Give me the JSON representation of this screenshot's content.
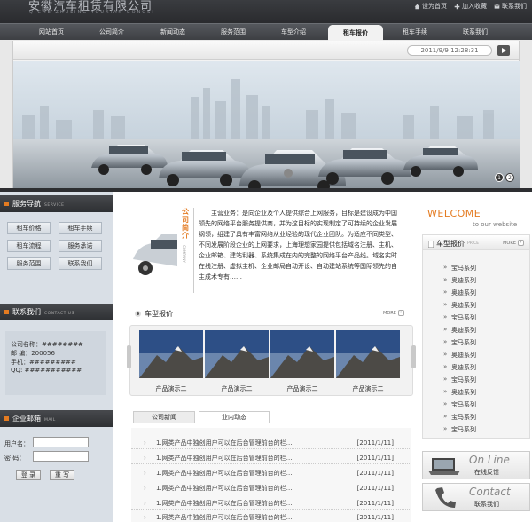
{
  "header": {
    "logo_cn": "安徽汽车租赁有限公司",
    "logo_pinyin": "QICHE ZHULING YOUXIAN GONGSI",
    "links": [
      "设为首页",
      "加入收藏",
      "联系我们"
    ]
  },
  "nav": {
    "items": [
      "网站首页",
      "公司简介",
      "新闻动态",
      "服务范围",
      "车型介绍",
      "租车报价",
      "租车手续",
      "联系我们"
    ],
    "active_index": 5
  },
  "banner": {
    "datetime": "2011/9/9 12:28:31",
    "slides": [
      "1",
      "2"
    ],
    "active_slide": 1
  },
  "sidebar": {
    "service_nav": {
      "title": "服务导航",
      "title_en": "SERVICE",
      "buttons": [
        "租车价格",
        "租车手续",
        "租车流程",
        "服务承诺",
        "服务范围",
        "联系我们"
      ]
    },
    "contact": {
      "title": "联系我们",
      "title_en": "CONTACT US",
      "lines": [
        "公司名称：########",
        "邮    编：200056",
        "手机：#########",
        "QQ: ###########"
      ]
    },
    "mail": {
      "title": "企业邮箱",
      "title_en": "MAIL",
      "user_label": "用户名：",
      "pass_label": "密    码：",
      "login_button": "登 录",
      "reset_button": "重 写"
    }
  },
  "intro": {
    "title_chars": [
      "公",
      "司",
      "简",
      "介"
    ],
    "subtitle": "COMPANY",
    "text": "主营业务：是向企业及个人提供综合上网服务，目标是建设成为中国领先的网络平台服务提供商，并为这目标的实现制定了可持续的企业发展纲领，组建了具有丰富网络从业经验的现代企业团队。为适应不同类型、不同发展阶段企业的上网要求，上海理想家园提供包括域名注册、主机、企业邮箱、建站利器、系统集成在内的完整的网络平台产品线。域名实时在线注册、虚拟主机、企业邮局自动开设、自动建站系统等国际领先的自主成术专有……"
  },
  "models_section": {
    "title": "车型报价",
    "more": "MORE",
    "items": [
      "产品演示二",
      "产品演示二",
      "产品演示二",
      "产品演示二"
    ]
  },
  "news": {
    "tabs": [
      "公司新闻",
      "业内动态"
    ],
    "active_tab": 0,
    "rows": [
      {
        "title": "1.网类产品中独创用户可以在后台管理前台的栏…",
        "date": "[2011/1/11]"
      },
      {
        "title": "1.网类产品中独创用户可以在后台管理前台的栏…",
        "date": "[2011/1/11]"
      },
      {
        "title": "1.网类产品中独创用户可以在后台管理前台的栏…",
        "date": "[2011/1/11]"
      },
      {
        "title": "1.网类产品中独创用户可以在后台管理前台的栏…",
        "date": "[2011/1/11]"
      },
      {
        "title": "1.网类产品中独创用户可以在后台管理前台的栏…",
        "date": "[2011/1/11]"
      },
      {
        "title": "1.网类产品中独创用户可以在后台管理前台的栏…",
        "date": "[2011/1/11]"
      }
    ]
  },
  "right": {
    "welcome": "WELCOME",
    "welcome_sub": "to our website",
    "price_box": {
      "title": "车型报价",
      "title_en": "PRICE",
      "more": "MORE",
      "items": [
        "宝马系列",
        "奥迪系列",
        "奥迪系列",
        "奥迪系列",
        "宝马系列",
        "奥迪系列",
        "宝马系列",
        "奥迪系列",
        "奥迪系列",
        "宝马系列",
        "奥迪系列",
        "宝马系列",
        "宝马系列",
        "宝马系列"
      ]
    },
    "online": {
      "big": "On Line",
      "small": "在线反馈"
    },
    "contact": {
      "big": "Contact",
      "small": "联系我们"
    }
  },
  "colors": {
    "accent": "#e47b21",
    "dark_bar": "#2e3033",
    "sidebar_bg": "#d9dfe6"
  }
}
